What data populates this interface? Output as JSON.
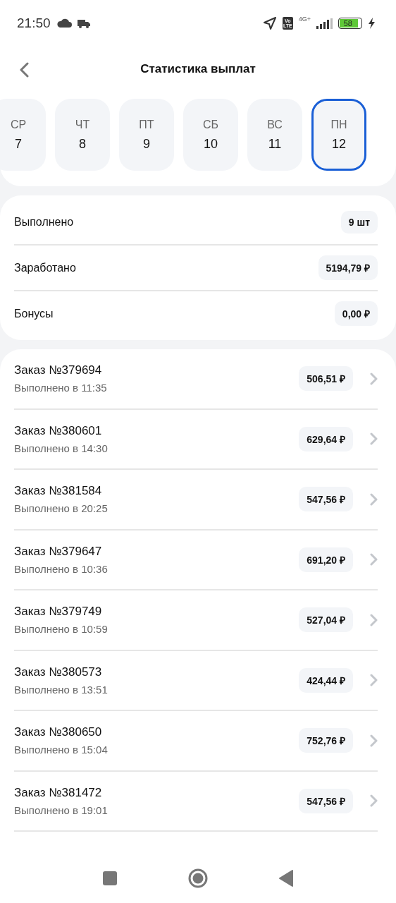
{
  "status_bar": {
    "time": "21:50",
    "volte": "Vo LTE",
    "network": "4G+",
    "battery": "58"
  },
  "header": {
    "title": "Статистика выплат"
  },
  "days": [
    {
      "weekday": "СР",
      "day": "7",
      "selected": false
    },
    {
      "weekday": "ЧТ",
      "day": "8",
      "selected": false
    },
    {
      "weekday": "ПТ",
      "day": "9",
      "selected": false
    },
    {
      "weekday": "СБ",
      "day": "10",
      "selected": false
    },
    {
      "weekday": "ВС",
      "day": "11",
      "selected": false
    },
    {
      "weekday": "ПН",
      "day": "12",
      "selected": true
    }
  ],
  "summary": [
    {
      "label": "Выполнено",
      "value": "9 шт"
    },
    {
      "label": "Заработано",
      "value": "5194,79 ₽"
    },
    {
      "label": "Бонусы",
      "value": "0,00 ₽"
    }
  ],
  "orders": [
    {
      "title": "Заказ №379694",
      "subtitle": "Выполнено в 11:35",
      "amount": "506,51 ₽"
    },
    {
      "title": "Заказ №380601",
      "subtitle": "Выполнено в 14:30",
      "amount": "629,64 ₽"
    },
    {
      "title": "Заказ №381584",
      "subtitle": "Выполнено в 20:25",
      "amount": "547,56 ₽"
    },
    {
      "title": "Заказ №379647",
      "subtitle": "Выполнено в 10:36",
      "amount": "691,20 ₽"
    },
    {
      "title": "Заказ №379749",
      "subtitle": "Выполнено в 10:59",
      "amount": "527,04 ₽"
    },
    {
      "title": "Заказ №380573",
      "subtitle": "Выполнено в 13:51",
      "amount": "424,44 ₽"
    },
    {
      "title": "Заказ №380650",
      "subtitle": "Выполнено в 15:04",
      "amount": "752,76 ₽"
    },
    {
      "title": "Заказ №381472",
      "subtitle": "Выполнено в 19:01",
      "amount": "547,56 ₽"
    }
  ]
}
